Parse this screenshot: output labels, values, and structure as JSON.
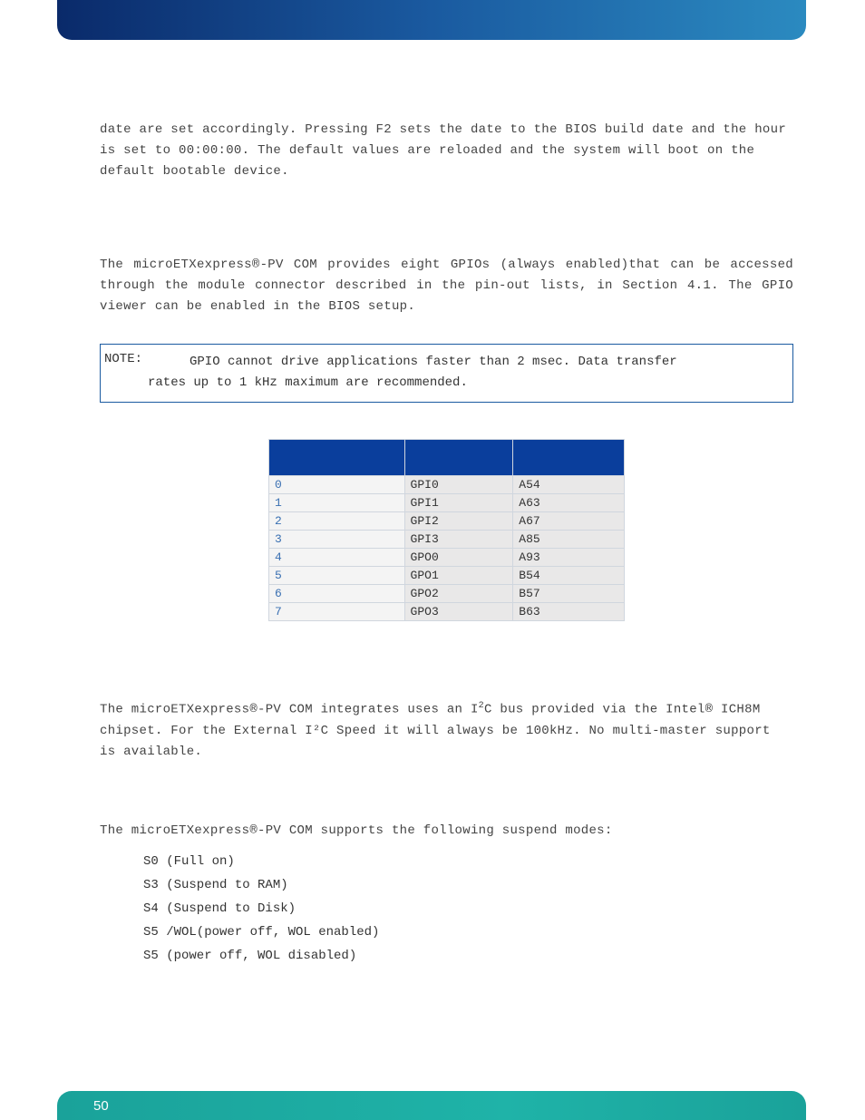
{
  "paragraphs": {
    "p1": "date are set accordingly.  Pressing F2 sets the date to the BIOS build date and the hour is set to 00:00:00.  The default values are reloaded and the system will boot on the default bootable device.",
    "p2": "The microETXexpress®-PV COM provides eight GPIOs (always enabled)that can be accessed through the module connector described in the pin-out lists, in Section 4.1. The GPIO viewer can be enabled in the BIOS setup.",
    "p3_pre": "The microETXexpress®-PV COM integrates uses an I",
    "p3_sup": "2",
    "p3_post": "C bus provided via the Intel® ICH8M chipset. For the External I²C Speed it will always be 100kHz. No multi-master support is available.",
    "p4": "The microETXexpress®-PV COM supports the following suspend modes:"
  },
  "note": {
    "label": "NOTE:",
    "line1": "GPIO cannot drive applications faster than 2 msec. Data transfer",
    "line2": "rates up to 1 kHz maximum are recommended."
  },
  "table": {
    "headers": [
      "",
      "",
      ""
    ],
    "rows": [
      {
        "idx": "0",
        "name": "GPI0",
        "pin": "A54"
      },
      {
        "idx": "1",
        "name": "GPI1",
        "pin": "A63"
      },
      {
        "idx": "2",
        "name": "GPI2",
        "pin": "A67"
      },
      {
        "idx": "3",
        "name": "GPI3",
        "pin": "A85"
      },
      {
        "idx": "4",
        "name": "GPO0",
        "pin": "A93"
      },
      {
        "idx": "5",
        "name": "GPO1",
        "pin": "B54"
      },
      {
        "idx": "6",
        "name": "GPO2",
        "pin": "B57"
      },
      {
        "idx": "7",
        "name": "GPO3",
        "pin": "B63"
      }
    ]
  },
  "suspend_modes": [
    "S0 (Full on)",
    "S3 (Suspend to RAM)",
    "S4 (Suspend to Disk)",
    "S5 /WOL(power off, WOL enabled)",
    "S5 (power off, WOL disabled)"
  ],
  "footer": {
    "page_number": "50"
  }
}
